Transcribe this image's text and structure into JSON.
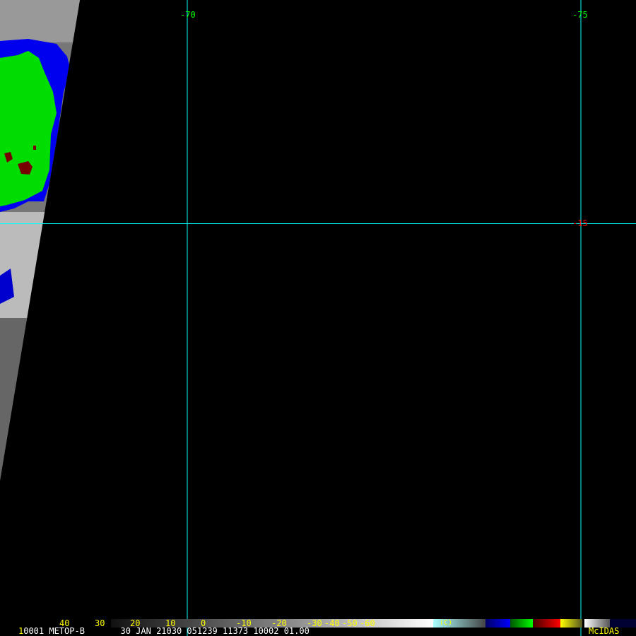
{
  "satellite": "METOP-B",
  "grid_labels": {
    "lon_left": "-70",
    "lon_right": "-75",
    "lat": "-15"
  },
  "colors": {
    "lon_label": "#00ff00",
    "lat_label": "#ff0000",
    "grid": "#00ffff",
    "scale_text": "#ffff00"
  },
  "color_scale": {
    "ticks": [
      "40",
      "30",
      "20",
      "10",
      "0",
      "-10",
      "-20",
      "-30",
      "-40",
      "-50",
      "-60"
    ],
    "unit": "(C)"
  },
  "info_line": {
    "prefix": "1",
    "text": "0001 METOP-B       30 JAN 21030 051239 11373 10002 01.00"
  },
  "brand": "McIDAS"
}
